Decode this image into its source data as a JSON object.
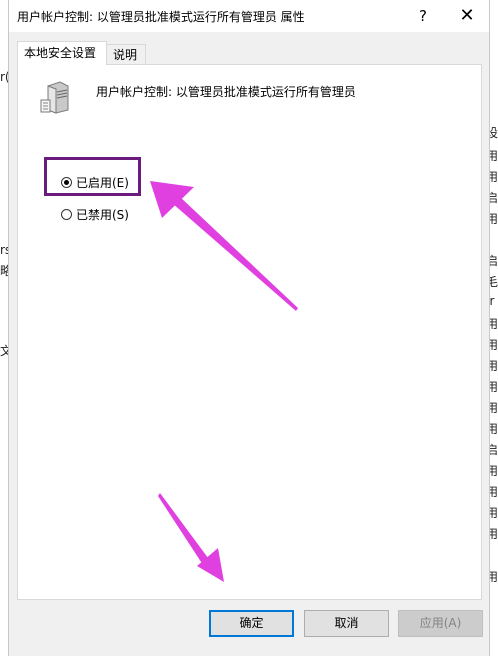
{
  "window": {
    "title": "用户帐户控制: 以管理员批准模式运行所有管理员 属性",
    "help_label": "?",
    "close_label": "✕"
  },
  "tabs": [
    {
      "label": "本地安全设置",
      "active": true
    },
    {
      "label": "说明",
      "active": false
    }
  ],
  "policy": {
    "icon": "server-policy-icon",
    "name": "用户帐户控制: 以管理员批准模式运行所有管理员"
  },
  "options": [
    {
      "label": "已启用(E)",
      "checked": true
    },
    {
      "label": "已禁用(S)",
      "checked": false
    }
  ],
  "buttons": {
    "ok": "确定",
    "cancel": "取消",
    "apply": "应用(A)"
  },
  "background": {
    "left_fragments": [
      "r(",
      "rs",
      "略",
      "文"
    ],
    "right_fragments": [
      "设",
      "用",
      "用",
      "启",
      "用",
      "启",
      "毛",
      "Ir",
      "用",
      "用",
      "用",
      "用",
      "用",
      "用",
      "启",
      "用",
      "用",
      "用",
      "用",
      "用"
    ]
  },
  "colors": {
    "highlight_box": "#6b1a7e",
    "arrow": "#e040e0",
    "ok_border": "#0078d7"
  }
}
